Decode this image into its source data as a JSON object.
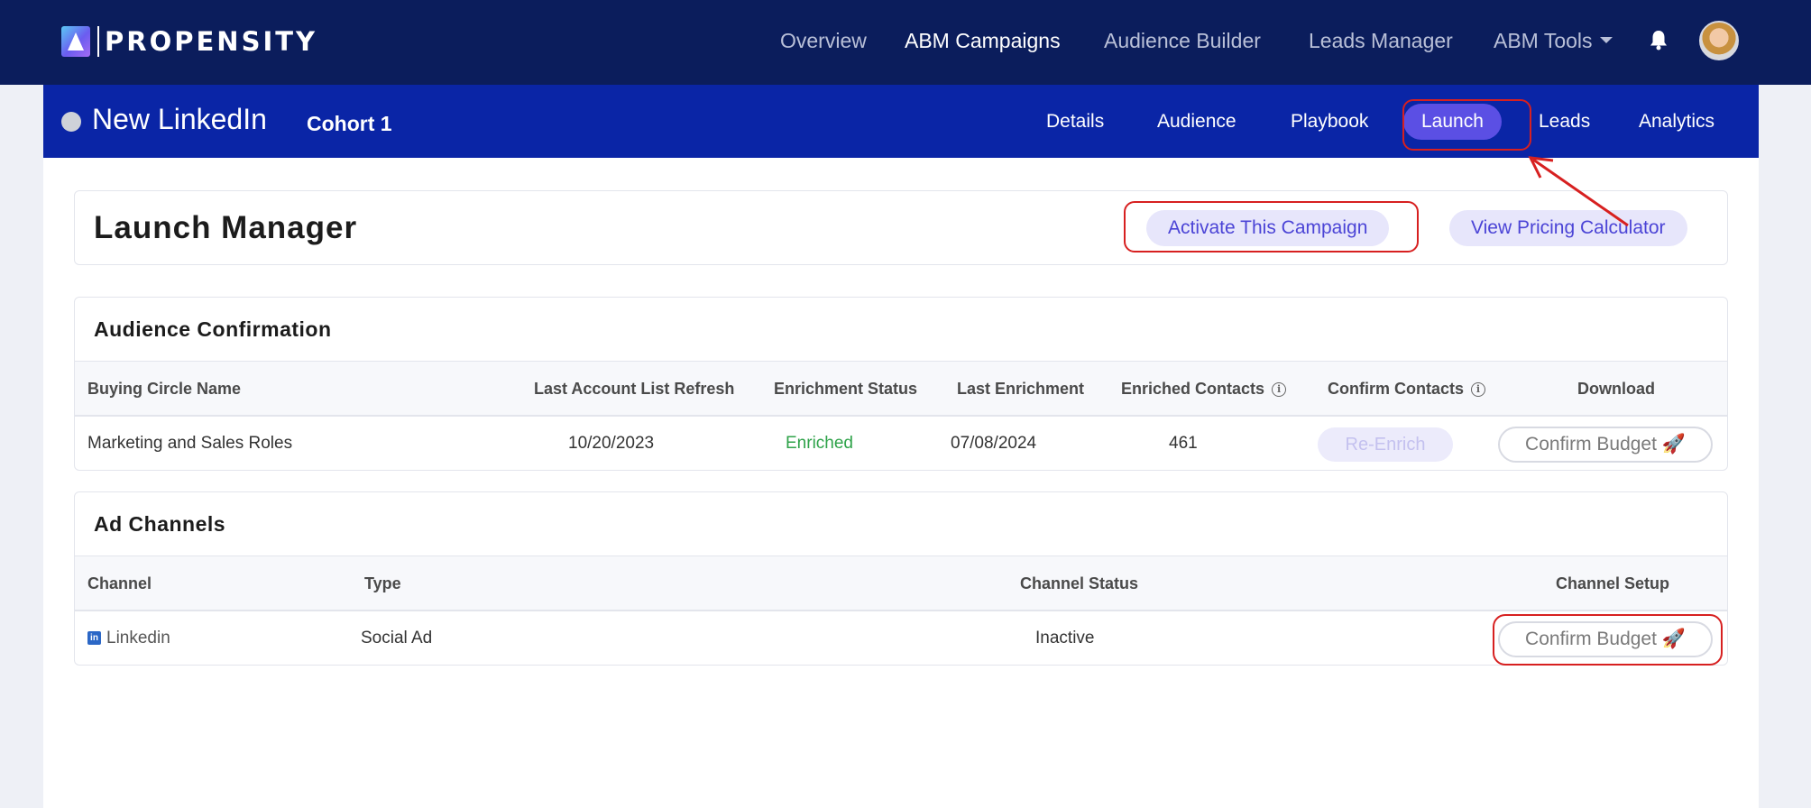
{
  "brand": {
    "name": "PROPENSITY"
  },
  "topnav": {
    "items": [
      {
        "label": "Overview"
      },
      {
        "label": "ABM Campaigns"
      },
      {
        "label": "Audience Builder"
      },
      {
        "label": "Leads Manager"
      },
      {
        "label": "ABM Tools"
      }
    ]
  },
  "campaign": {
    "name": "New LinkedIn",
    "cohort": "Cohort 1",
    "tabs": [
      {
        "label": "Details"
      },
      {
        "label": "Audience"
      },
      {
        "label": "Playbook"
      },
      {
        "label": "Launch"
      },
      {
        "label": "Leads"
      },
      {
        "label": "Analytics"
      }
    ]
  },
  "launch": {
    "title": "Launch Manager",
    "activate_label": "Activate This Campaign",
    "pricing_label": "View Pricing Calculator"
  },
  "audience": {
    "title": "Audience Confirmation",
    "columns": [
      "Buying Circle Name",
      "Last Account List Refresh",
      "Enrichment Status",
      "Last Enrichment",
      "Enriched Contacts",
      "Confirm Contacts",
      "Download"
    ],
    "row": {
      "name": "Marketing and Sales Roles",
      "last_refresh": "10/20/2023",
      "status": "Enriched",
      "last_enrichment": "07/08/2024",
      "contacts": "461",
      "reenrich_label": "Re-Enrich",
      "confirm_label": "Confirm Budget 🚀"
    }
  },
  "channels": {
    "title": "Ad Channels",
    "columns": [
      "Channel",
      "Type",
      "Channel Status",
      "Channel Setup"
    ],
    "row": {
      "channel": "Linkedin",
      "type": "Social Ad",
      "status": "Inactive",
      "confirm_label": "Confirm Budget 🚀"
    }
  },
  "colors": {
    "topnav_bg": "#0b1d5c",
    "campaign_bar_bg": "#0a25a6",
    "active_tab": "#5b4fe4",
    "annotation": "#d72020",
    "enriched": "#2fa34a"
  }
}
